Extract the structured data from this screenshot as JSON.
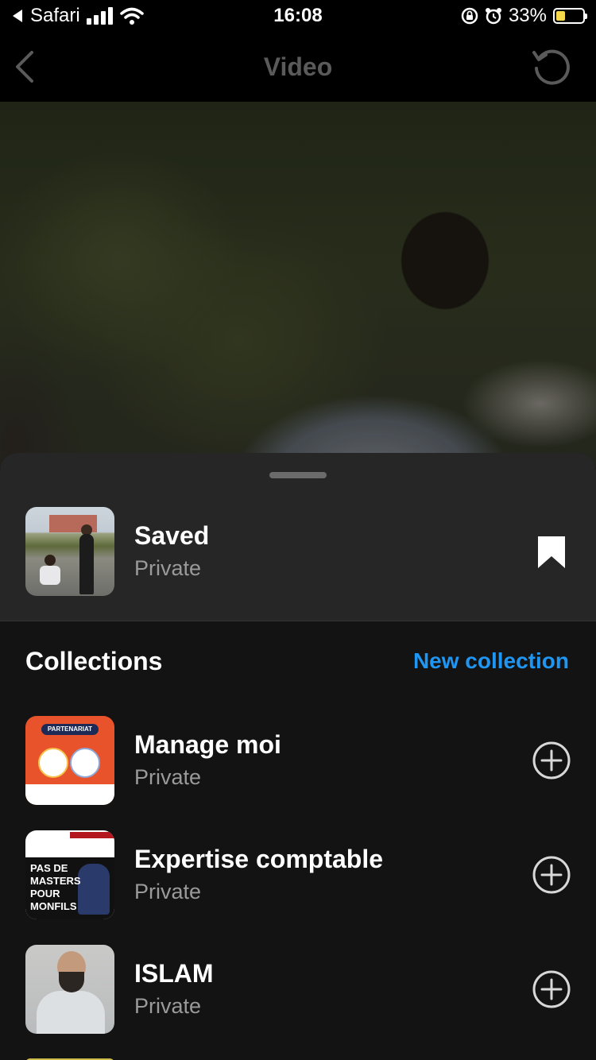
{
  "status_bar": {
    "back_app": "Safari",
    "time": "16:08",
    "battery": "33%",
    "battery_level": 0.33
  },
  "nav": {
    "title": "Video"
  },
  "saved": {
    "title": "Saved",
    "privacy": "Private"
  },
  "collections": {
    "header": "Collections",
    "new_label": "New collection",
    "items": [
      {
        "title": "Manage moi",
        "privacy": "Private",
        "thumb_text": "PARTENARIAT"
      },
      {
        "title": "Expertise comptable",
        "privacy": "Private",
        "thumb_text": "PAS DE MASTERS POUR MONFILS"
      },
      {
        "title": "ISLAM",
        "privacy": "Private"
      }
    ]
  },
  "colors": {
    "accent": "#1f96f2",
    "sheet_background": "#131313",
    "sheet_header_background": "#262626"
  }
}
